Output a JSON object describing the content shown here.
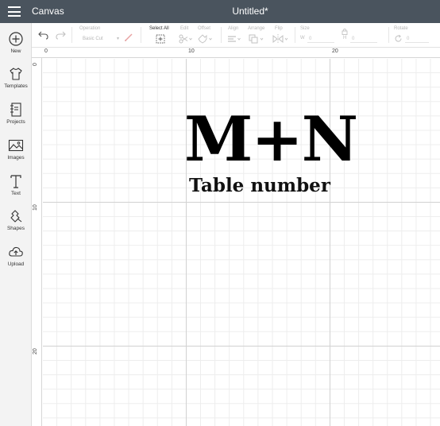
{
  "titlebar": {
    "app_title": "Canvas",
    "doc_title": "Untitled*",
    "bg_color": "#4a545e"
  },
  "sidebar": {
    "items": [
      {
        "label": "New",
        "icon": "plus-circle-icon"
      },
      {
        "label": "Templates",
        "icon": "tshirt-icon"
      },
      {
        "label": "Projects",
        "icon": "projects-icon"
      },
      {
        "label": "Images",
        "icon": "image-icon"
      },
      {
        "label": "Text",
        "icon": "text-icon"
      },
      {
        "label": "Shapes",
        "icon": "shapes-icon"
      },
      {
        "label": "Upload",
        "icon": "upload-cloud-icon"
      }
    ]
  },
  "toolbar": {
    "undo_icon": "undo-icon",
    "redo_icon": "redo-icon",
    "operation_label": "Operation",
    "operation_value": "Basic Cut",
    "select_all_label": "Select All",
    "edit_label": "Edit",
    "offset_label": "Offset",
    "align_label": "Align",
    "arrange_label": "Arrange",
    "flip_label": "Flip",
    "size_label": "Size",
    "width_label": "W",
    "width_value": "0",
    "height_label": "H",
    "height_value": "0",
    "rotate_label": "Rotate",
    "rotate_value": "0"
  },
  "rulers": {
    "top": [
      "0",
      "10",
      "20"
    ],
    "left": [
      "0",
      "10",
      "20"
    ]
  },
  "canvas": {
    "monogram": "M+N",
    "subtitle": "Table number"
  }
}
